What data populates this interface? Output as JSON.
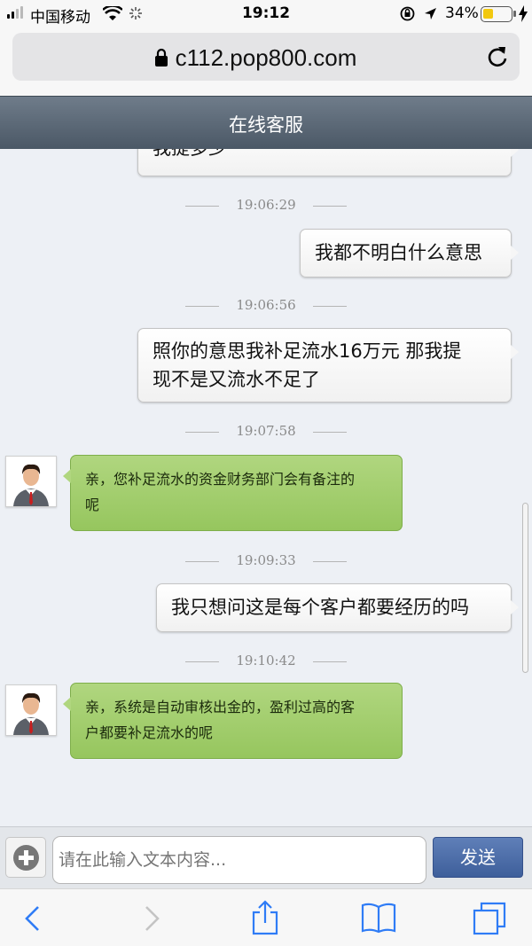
{
  "status": {
    "carrier": "中国移动",
    "time": "19:12",
    "battery": "34%"
  },
  "browser": {
    "url": "c112.pop800.com"
  },
  "header": {
    "title": "在线客服"
  },
  "messages": [
    {
      "type": "user",
      "text": "我提多少"
    },
    {
      "type": "time",
      "text": "19:06:29"
    },
    {
      "type": "user",
      "text": "我都不明白什么意思"
    },
    {
      "type": "time",
      "text": "19:06:56"
    },
    {
      "type": "user",
      "line1": "照你的意思我补足流水16万元 那我提",
      "line2": "现不是又流水不足了"
    },
    {
      "type": "time",
      "text": "19:07:58"
    },
    {
      "type": "agent",
      "line1": "亲，您补足流水的资金财务部门会有备注的",
      "line2": "呢"
    },
    {
      "type": "time",
      "text": "19:09:33"
    },
    {
      "type": "user",
      "text": "我只想问这是每个客户都要经历的吗"
    },
    {
      "type": "time",
      "text": "19:10:42"
    },
    {
      "type": "agent",
      "line1": "亲，系统是自动审核出金的，盈利过高的客",
      "line2": "户都要补足流水的呢"
    }
  ],
  "input": {
    "placeholder": "请在此输入文本内容...",
    "send_label": "发送"
  },
  "icons": [
    "lock-icon",
    "reload-icon",
    "add-icon",
    "back-icon",
    "forward-icon",
    "share-icon",
    "bookmarks-icon",
    "tabs-icon"
  ]
}
